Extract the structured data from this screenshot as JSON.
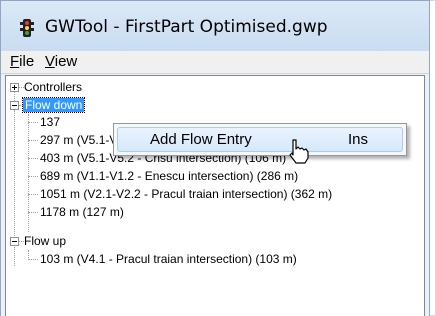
{
  "window": {
    "title": "GWTool - FirstPart Optimised.gwp"
  },
  "menu": [
    {
      "label_mnemonic": "F",
      "label_rest": "ile"
    },
    {
      "label_mnemonic": "V",
      "label_rest": "iew"
    }
  ],
  "tree": {
    "controllers": "Controllers",
    "flow_down": "Flow down",
    "flow_down_items": [
      "137",
      "297 m (V5.1-V5.2 - First 2 intersections) (160 m)",
      "403 m (V5.1-V5.2 - Crisu intersection) (106 m)",
      "689 m (V1.1-V1.2 - Enescu intersection) (286 m)",
      "1051 m (V2.1-V2.2 - Pracul traian intersection) (362 m)",
      "1178 m (127 m)"
    ],
    "flow_up": "Flow up",
    "flow_up_items": [
      "103 m (V4.1 - Pracul traian intersection) (103 m)"
    ]
  },
  "context_menu": {
    "items": [
      {
        "label": "Add Flow Entry",
        "shortcut": "Ins"
      }
    ]
  },
  "colors": {
    "selection": "#3399ff",
    "titlebar": "#c9dcf1"
  }
}
